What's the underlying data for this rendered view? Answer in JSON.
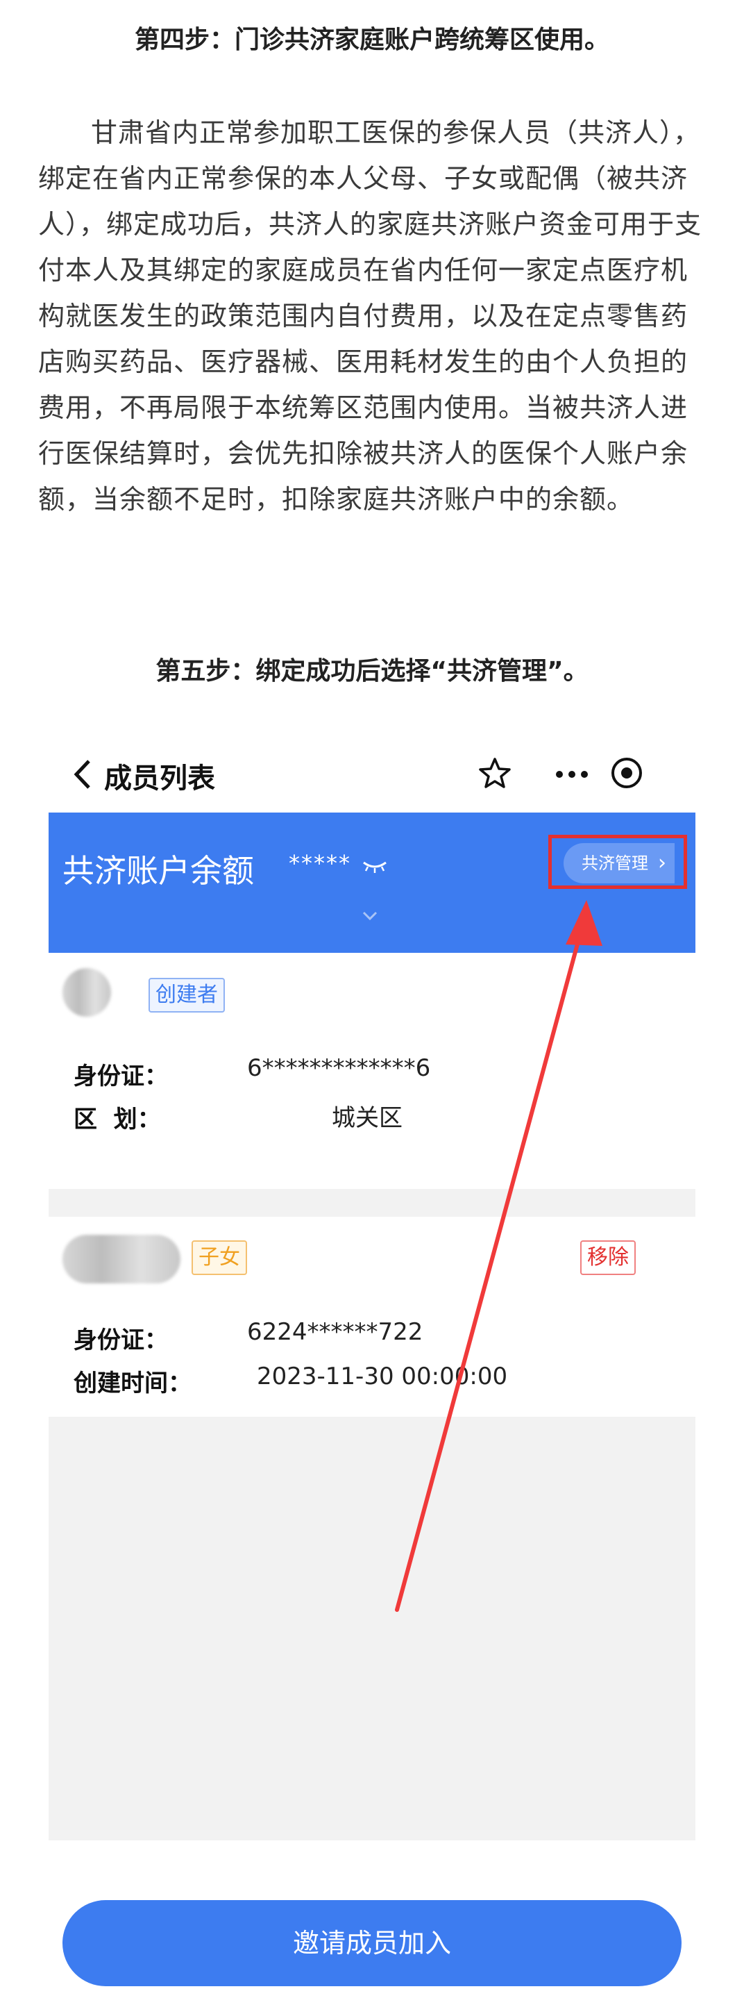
{
  "article": {
    "step4_title": "第四步：门诊共济家庭账户跨统筹区使用。",
    "paragraph": "甘肃省内正常参加职工医保的参保人员（共济人），绑定在省内正常参保的本人父母、子女或配偶（被共济人），绑定成功后，共济人的家庭共济账户资金可用于支付本人及其绑定的家庭成员在省内任何一家定点医疗机构就医发生的政策范围内自付费用，以及在定点零售药店购买药品、医疗器械、医用耗材发生的由个人负担的费用，不再局限于本统筹区范围内使用。当被共济人进行医保结算时，会优先扣除被共济人的医保个人账户余额，当余额不足时，扣除家庭共济账户中的余额。",
    "step5_title": "第五步：绑定成功后选择“共济管理”。"
  },
  "screen": {
    "page_title": "成员列表",
    "banner": {
      "label": "共济账户余额",
      "masked_value": "*****",
      "manage_button": "共济管理",
      "manage_chevron": "›",
      "color": "#3d7cf0"
    },
    "members": [
      {
        "tag": "创建者",
        "id_label": "身份证：",
        "id_value": "6*************6",
        "region_label": "区  划：",
        "region_value": "城关区"
      },
      {
        "tag": "子女",
        "remove_label": "移除",
        "id_label": "身份证：",
        "id_value": "6224******722",
        "time_label": "创建时间：",
        "time_value": "2023-11-30 00:00:00"
      }
    ],
    "invite_button": "邀请成员加入"
  },
  "icons": [
    "back-icon",
    "star-icon",
    "more-icon",
    "target-icon",
    "eye-closed-icon",
    "chevron-down-icon"
  ],
  "colors": {
    "accent": "#3d7cf0",
    "highlight": "#e3302f",
    "arrow": "#f03a3a"
  }
}
